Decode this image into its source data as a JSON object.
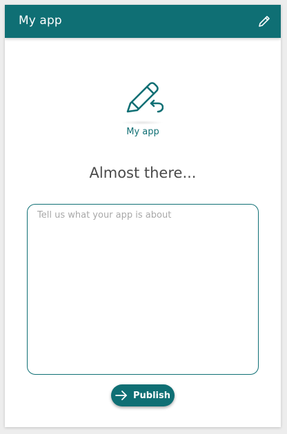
{
  "colors": {
    "accent": "#0f6f74",
    "header_text": "#ffffff",
    "heading_text": "#4a4a4a",
    "placeholder_text": "#a8a8a8"
  },
  "header": {
    "title": "My app",
    "edit_icon": "pencil-icon"
  },
  "app": {
    "icon": "pencil-undo-icon",
    "name": "My app"
  },
  "main": {
    "heading": "Almost there...",
    "description_placeholder": "Tell us what your app is about",
    "description_value": ""
  },
  "publish_button": {
    "icon": "arrow-right-icon",
    "label": "Publish"
  }
}
